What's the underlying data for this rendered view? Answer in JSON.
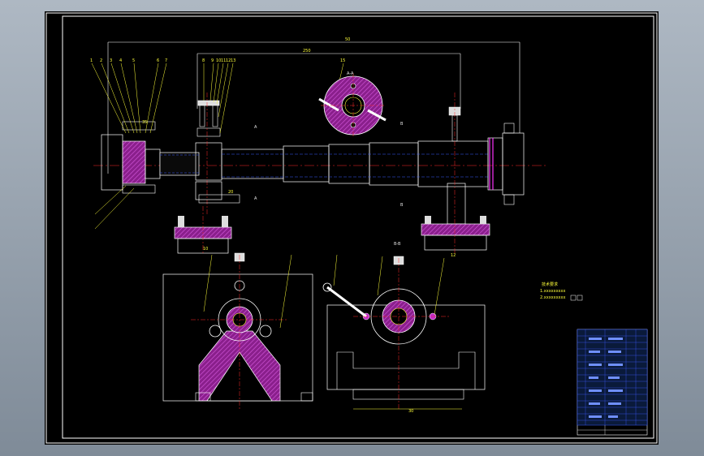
{
  "drawing": {
    "background": "#000000",
    "frame_color": "#ffffff",
    "line_colors": {
      "outline": "#ffffff",
      "hatch": "#c22ac6",
      "center": "#ff2a2a",
      "hidden": "#3a5cff",
      "dimension": "#ffff3a",
      "highlight": "#ff33ff"
    },
    "overall_dimension": "50",
    "upper_dimension": "250",
    "section_label_a": "A-A",
    "section_label_b": "B-B",
    "tech_note_title": "技术要求",
    "tech_note_lines": [
      "1.xxxxxxxxx",
      "2.xxxxxxxxx"
    ],
    "view_labels": [
      "A",
      "A",
      "B",
      "B"
    ],
    "balloon_numbers_left": [
      "1",
      "2",
      "3",
      "4",
      "5",
      "6",
      "7"
    ],
    "balloon_numbers_mid": [
      "8",
      "9",
      "10",
      "11",
      "12",
      "13"
    ],
    "balloon_number_top": "15",
    "dim_small": [
      "10",
      "12",
      "20",
      "35",
      "44",
      "30"
    ]
  }
}
